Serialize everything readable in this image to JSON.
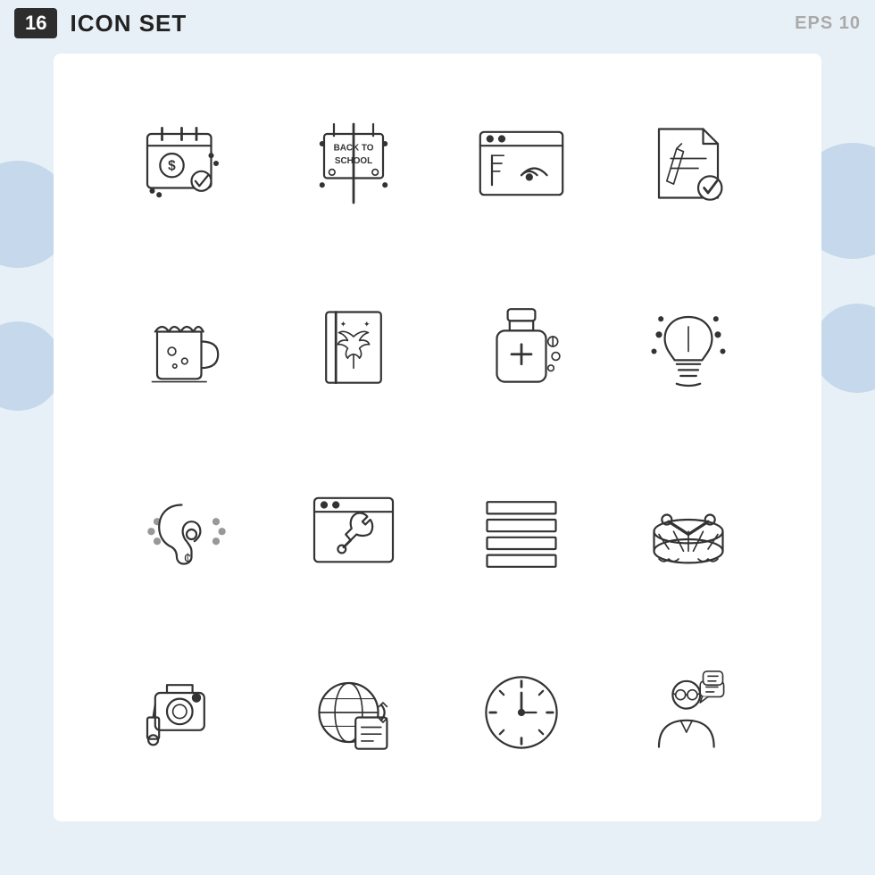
{
  "header": {
    "badge": "16",
    "title": "ICON SET",
    "eps": "EPS 10"
  },
  "icons": [
    {
      "name": "payment-schedule",
      "description": "Calendar with dollar coin and checkmark"
    },
    {
      "name": "back-to-school",
      "description": "Sign board saying BACK TO SCHOOL"
    },
    {
      "name": "wifi-browser",
      "description": "Browser window with wifi signal"
    },
    {
      "name": "document-check",
      "description": "Document with pen and checkmark"
    },
    {
      "name": "beer-mug",
      "description": "Beer mug with foam"
    },
    {
      "name": "cannabis-book",
      "description": "Book with cannabis leaf"
    },
    {
      "name": "medicine-bottle",
      "description": "Medicine bottle with pills"
    },
    {
      "name": "idea-bulb",
      "description": "Light bulb with sparkles"
    },
    {
      "name": "hearing-accessibility",
      "description": "Ear with sound waves"
    },
    {
      "name": "web-settings",
      "description": "Browser window with wrench"
    },
    {
      "name": "menu-lines",
      "description": "Horizontal lines menu"
    },
    {
      "name": "drum",
      "description": "Drum with sticks"
    },
    {
      "name": "camera",
      "description": "Video camera on mount"
    },
    {
      "name": "global-news",
      "description": "Globe with document and arrows"
    },
    {
      "name": "clock",
      "description": "Analog clock"
    },
    {
      "name": "consultant",
      "description": "Person with speech bubbles"
    }
  ]
}
